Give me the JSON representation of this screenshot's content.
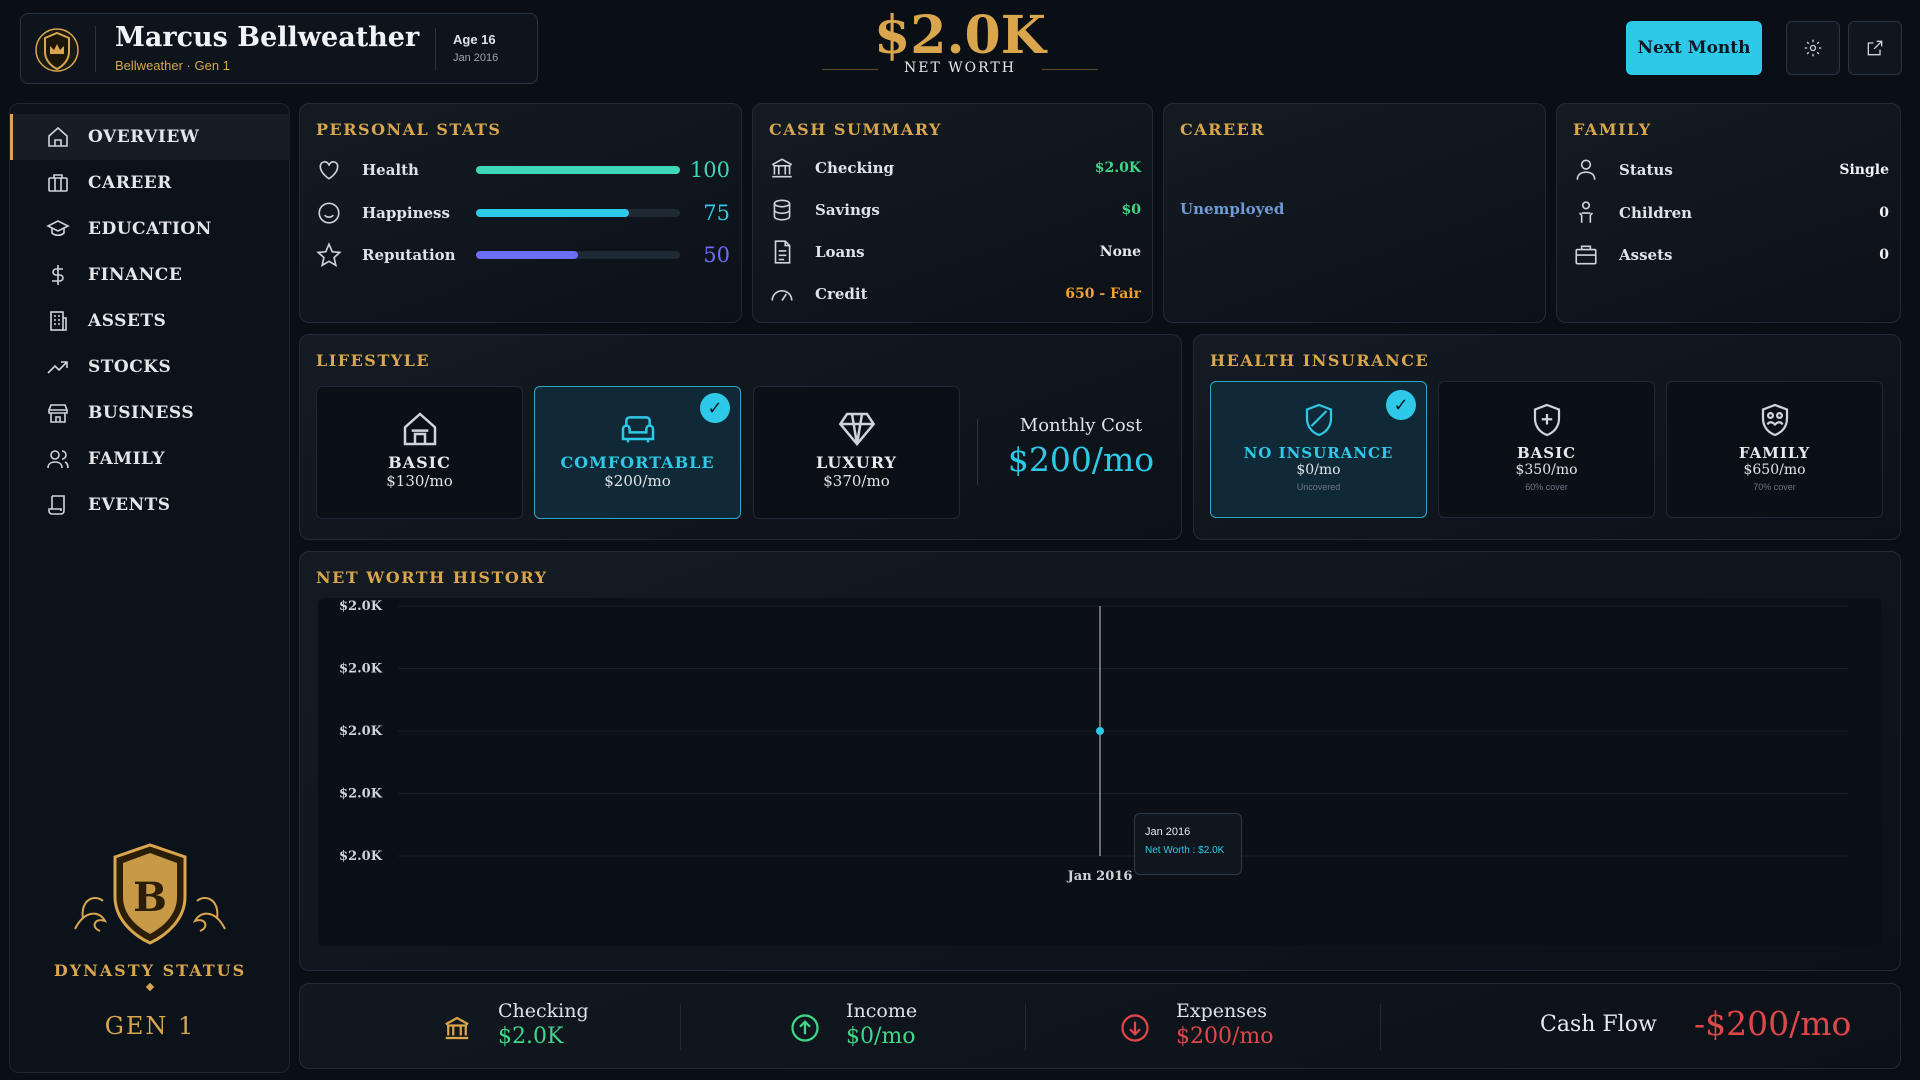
{
  "header": {
    "name": "Marcus Bellweather",
    "subtitle": "Bellweather · Gen 1",
    "age": "Age  16",
    "date": "Jan 2016",
    "net_worth": "$2.0K",
    "net_worth_label": "NET WORTH",
    "next_button": "Next Month",
    "settings_icon": "gear-icon",
    "external_icon": "external-link-icon"
  },
  "sidebar": {
    "items": [
      {
        "label": "OVERVIEW",
        "icon": "home-icon",
        "active": true
      },
      {
        "label": "CAREER",
        "icon": "briefcase-icon"
      },
      {
        "label": "EDUCATION",
        "icon": "graduation-cap-icon"
      },
      {
        "label": "FINANCE",
        "icon": "dollar-icon"
      },
      {
        "label": "ASSETS",
        "icon": "building-icon"
      },
      {
        "label": "STOCKS",
        "icon": "trending-up-icon"
      },
      {
        "label": "BUSINESS",
        "icon": "store-icon"
      },
      {
        "label": "FAMILY",
        "icon": "users-icon"
      },
      {
        "label": "EVENTS",
        "icon": "scroll-icon"
      }
    ],
    "dynasty_label": "DYNASTY STATUS",
    "dynasty_gen": "GEN 1",
    "crest_letter": "B"
  },
  "personal_stats": {
    "title": "PERSONAL STATS",
    "rows": [
      {
        "label": "Health",
        "value": "100",
        "level": 1.0,
        "color": "#3fd7b8"
      },
      {
        "label": "Happiness",
        "value": "75",
        "level": 0.75,
        "color": "#2ec9e8"
      },
      {
        "label": "Reputation",
        "value": "50",
        "level": 0.5,
        "color": "#6b6ef5"
      }
    ]
  },
  "cash_summary": {
    "title": "CASH SUMMARY",
    "rows": [
      {
        "label": "Checking",
        "value": "$2.0K",
        "color": "#3fd78a"
      },
      {
        "label": "Savings",
        "value": "$0",
        "color": "#3fd78a"
      },
      {
        "label": "Loans",
        "value": "None",
        "color": "#e6e9ee"
      },
      {
        "label": "Credit",
        "value": "650 - Fair",
        "color": "#f0a030"
      }
    ]
  },
  "career": {
    "title": "CAREER",
    "status": "Unemployed"
  },
  "family": {
    "title": "FAMILY",
    "rows": [
      {
        "label": "Status",
        "value": "Single"
      },
      {
        "label": "Children",
        "value": "0"
      },
      {
        "label": "Assets",
        "value": "0"
      }
    ]
  },
  "lifestyle": {
    "title": "LIFESTYLE",
    "options": [
      {
        "name": "BASIC",
        "price": "$130/mo"
      },
      {
        "name": "COMFORTABLE",
        "price": "$200/mo",
        "selected": true
      },
      {
        "name": "LUXURY",
        "price": "$370/mo"
      }
    ],
    "monthly_cost_label": "Monthly Cost",
    "monthly_cost": "$200/mo"
  },
  "health_insurance": {
    "title": "HEALTH INSURANCE",
    "options": [
      {
        "name": "NO INSURANCE",
        "price": "$0/mo",
        "cover": "Uncovered",
        "selected": true
      },
      {
        "name": "BASIC",
        "price": "$350/mo",
        "cover": "60% cover"
      },
      {
        "name": "FAMILY",
        "price": "$650/mo",
        "cover": "70% cover"
      }
    ]
  },
  "net_worth_history": {
    "title": "NET WORTH HISTORY",
    "tooltip_date": "Jan 2016",
    "tooltip_value": "Net Worth : $2.0K"
  },
  "chart_data": {
    "type": "line",
    "x": [
      "Jan 2016"
    ],
    "series": [
      {
        "name": "Net Worth",
        "values": [
          2000
        ]
      }
    ],
    "y_tick_labels": [
      "$2.0K",
      "$2.0K",
      "$2.0K",
      "$2.0K",
      "$2.0K"
    ],
    "x_tick_labels": [
      "Jan 2016"
    ],
    "grid": true
  },
  "footer": {
    "checking_label": "Checking",
    "checking_value": "$2.0K",
    "income_label": "Income",
    "income_value": "$0/mo",
    "expenses_label": "Expenses",
    "expenses_value": "$200/mo",
    "cashflow_label": "Cash Flow",
    "cashflow_value": "-$200/mo"
  }
}
